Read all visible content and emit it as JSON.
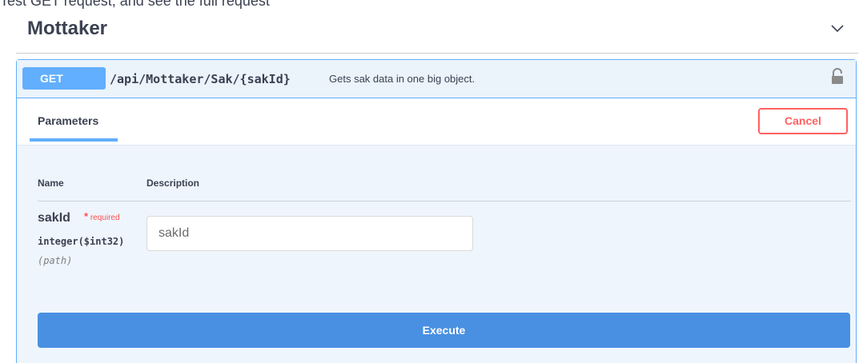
{
  "top_text": "Test GET request, and see the full request",
  "tag": {
    "title": "Mottaker"
  },
  "operation": {
    "method": "GET",
    "path": "/api/Mottaker/Sak/{sakId}",
    "description": "Gets sak data in one big object."
  },
  "params_tab": {
    "label": "Parameters",
    "cancel_label": "Cancel"
  },
  "table": {
    "col_name": "Name",
    "col_description": "Description"
  },
  "parameter": {
    "name": "sakId",
    "required_star": "*",
    "required_label": "required",
    "type": "integer($int32)",
    "in": "(path)",
    "placeholder": "sakId",
    "value": ""
  },
  "execute_label": "Execute",
  "colors": {
    "get": "#61affe",
    "execute": "#4990e2",
    "cancel": "#ff6060"
  },
  "icons": {
    "collapse": "chevron-down-icon",
    "auth": "unlock-icon"
  }
}
